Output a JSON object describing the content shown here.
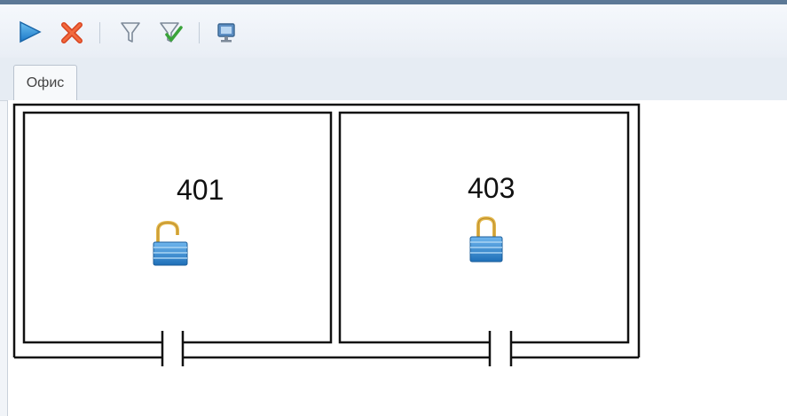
{
  "toolbar": {
    "buttons": [
      {
        "icon": "play-icon"
      },
      {
        "icon": "close-icon"
      },
      {
        "icon": "filter-icon"
      },
      {
        "icon": "filter-check-icon"
      },
      {
        "icon": "monitor-icon"
      }
    ]
  },
  "tabs": [
    {
      "label": "Офис",
      "selected": true
    }
  ],
  "floor_plan": {
    "rooms": [
      {
        "label": "401",
        "lock_state": "unlocked",
        "lock_icon": "unlock-icon"
      },
      {
        "label": "403",
        "lock_state": "locked",
        "lock_icon": "lock-icon"
      }
    ]
  }
}
